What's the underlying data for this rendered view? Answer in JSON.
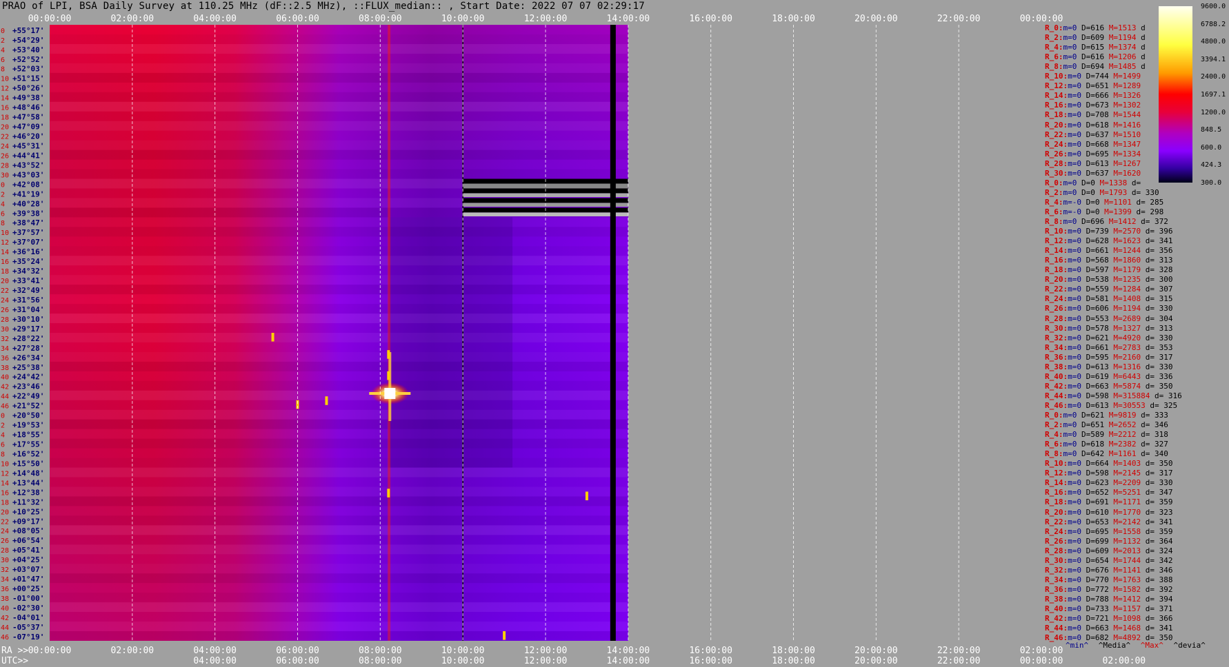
{
  "title": "PRAO of LPI, BSA Daily Survey at 110.25 MHz (dF::2.5 MHz), ::FLUX_median:: , Start Date: 2022 07 07 02:29:17",
  "chart_data": {
    "type": "heatmap",
    "top_axis_ticks": [
      "00:00:00",
      "02:00:00",
      "04:00:00",
      "06:00:00",
      "08:00:00",
      "10:00:00",
      "12:00:00",
      "14:00:00",
      "16:00:00",
      "18:00:00",
      "20:00:00",
      "22:00:00",
      "00:00:00"
    ],
    "ra_axis_label": "RA >>",
    "ra_ticks": [
      "00:00:00",
      "02:00:00",
      "04:00:00",
      "06:00:00",
      "08:00:00",
      "10:00:00",
      "12:00:00",
      "14:00:00",
      "16:00:00",
      "18:00:00",
      "20:00:00",
      "22:00:00",
      "02:00:00"
    ],
    "utc_axis_label": "UTC>>",
    "utc_ticks": [
      "04:00:00",
      "06:00:00",
      "08:00:00",
      "10:00:00",
      "12:00:00",
      "14:00:00",
      "16:00:00",
      "18:00:00",
      "20:00:00",
      "22:00:00",
      "00:00:00",
      "02:00:00"
    ],
    "row_numbers": [
      "0",
      "2",
      "4",
      "6",
      "8",
      "10",
      "12",
      "14",
      "16",
      "18",
      "20",
      "22",
      "24",
      "26",
      "28",
      "30",
      "0",
      "2",
      "4",
      "6",
      "8",
      "10",
      "12",
      "14",
      "16",
      "18",
      "20",
      "22",
      "24",
      "26",
      "28",
      "30",
      "32",
      "34",
      "36",
      "38",
      "40",
      "42",
      "44",
      "46",
      "0",
      "2",
      "4",
      "6",
      "8",
      "10",
      "12",
      "14",
      "16",
      "18",
      "20",
      "22",
      "24",
      "26",
      "28",
      "30",
      "32",
      "34",
      "36",
      "38",
      "40",
      "42",
      "44",
      "46"
    ],
    "declinations": [
      "+55°17'",
      "+54°29'",
      "+53°40'",
      "+52°52'",
      "+52°03'",
      "+51°15'",
      "+50°26'",
      "+49°38'",
      "+48°46'",
      "+47°58'",
      "+47°09'",
      "+46°20'",
      "+45°31'",
      "+44°41'",
      "+43°52'",
      "+43°03'",
      "+42°08'",
      "+41°19'",
      "+40°28'",
      "+39°38'",
      "+38°47'",
      "+37°57'",
      "+37°07'",
      "+36°16'",
      "+35°24'",
      "+34°32'",
      "+33°41'",
      "+32°49'",
      "+31°56'",
      "+31°04'",
      "+30°10'",
      "+29°17'",
      "+28°22'",
      "+27°28'",
      "+26°34'",
      "+25°38'",
      "+24°42'",
      "+23°46'",
      "+22°49'",
      "+21°52'",
      "+20°50'",
      "+19°53'",
      "+18°55'",
      "+17°55'",
      "+16°52'",
      "+15°50'",
      "+14°48'",
      "+13°44'",
      "+12°38'",
      "+11°32'",
      "+10°25'",
      "+09°17'",
      "+08°05'",
      "+06°54'",
      "+05°41'",
      "+04°25'",
      "+03°07'",
      "+01°47'",
      "+00°25'",
      "-01°00'",
      "-02°30'",
      "-04°01'",
      "-05°37'",
      "-07°19'"
    ],
    "colorbar_ticks": [
      "9600.0",
      "6788.2",
      "4800.0",
      "3394.1",
      "2400.0",
      "1697.1",
      "1200.0",
      "848.5",
      "600.0",
      "424.3",
      "300.0"
    ],
    "data_end_hour": 14.0,
    "dropout_start_hour": 10.0,
    "colors": {
      "hot": "#e8002a",
      "warm": "#c800a0",
      "cool": "#8a00ff",
      "cold": "#6a00d8",
      "background": "#a0a0a0",
      "source": "#ffffc0"
    }
  },
  "stats": [
    {
      "label": "R_0:",
      "m": "m=0",
      "D": "D=616",
      "M": "M=1513",
      "d": "d"
    },
    {
      "label": "R_2:",
      "m": "m=0",
      "D": "D=609",
      "M": "M=1194",
      "d": "d"
    },
    {
      "label": "R_4:",
      "m": "m=0",
      "D": "D=615",
      "M": "M=1374",
      "d": "d"
    },
    {
      "label": "R_6:",
      "m": "m=0",
      "D": "D=616",
      "M": "M=1206",
      "d": "d"
    },
    {
      "label": "R_8:",
      "m": "m=0",
      "D": "D=694",
      "M": "M=1485",
      "d": "d"
    },
    {
      "label": "R_10:",
      "m": "m=0",
      "D": "D=744",
      "M": "M=1499",
      "d": ""
    },
    {
      "label": "R_12:",
      "m": "m=0",
      "D": "D=651",
      "M": "M=1289",
      "d": ""
    },
    {
      "label": "R_14:",
      "m": "m=0",
      "D": "D=666",
      "M": "M=1326",
      "d": ""
    },
    {
      "label": "R_16:",
      "m": "m=0",
      "D": "D=673",
      "M": "M=1302",
      "d": ""
    },
    {
      "label": "R_18:",
      "m": "m=0",
      "D": "D=708",
      "M": "M=1544",
      "d": ""
    },
    {
      "label": "R_20:",
      "m": "m=0",
      "D": "D=618",
      "M": "M=1416",
      "d": ""
    },
    {
      "label": "R_22:",
      "m": "m=0",
      "D": "D=637",
      "M": "M=1510",
      "d": ""
    },
    {
      "label": "R_24:",
      "m": "m=0",
      "D": "D=668",
      "M": "M=1347",
      "d": ""
    },
    {
      "label": "R_26:",
      "m": "m=0",
      "D": "D=695",
      "M": "M=1334",
      "d": ""
    },
    {
      "label": "R_28:",
      "m": "m=0",
      "D": "D=613",
      "M": "M=1267",
      "d": ""
    },
    {
      "label": "R_30:",
      "m": "m=0",
      "D": "D=637",
      "M": "M=1620",
      "d": ""
    },
    {
      "label": "R_0:",
      "m": "m=0",
      "D": "D=0",
      "M": "M=1338",
      "d": "d="
    },
    {
      "label": "R_2:",
      "m": "m=0",
      "D": "D=0",
      "M": "M=1793",
      "d": "d= 330"
    },
    {
      "label": "R_4:",
      "m": "m=-0",
      "D": "D=0",
      "M": "M=1101",
      "d": "d= 285"
    },
    {
      "label": "R_6:",
      "m": "m=-0",
      "D": "D=0",
      "M": "M=1399",
      "d": "d= 298"
    },
    {
      "label": "R_8:",
      "m": "m=0",
      "D": "D=696",
      "M": "M=1412",
      "d": "d= 372"
    },
    {
      "label": "R_10:",
      "m": "m=0",
      "D": "D=739",
      "M": "M=2570",
      "d": "d= 396"
    },
    {
      "label": "R_12:",
      "m": "m=0",
      "D": "D=628",
      "M": "M=1623",
      "d": "d= 341"
    },
    {
      "label": "R_14:",
      "m": "m=0",
      "D": "D=661",
      "M": "M=1244",
      "d": "d= 356"
    },
    {
      "label": "R_16:",
      "m": "m=0",
      "D": "D=568",
      "M": "M=1860",
      "d": "d= 313"
    },
    {
      "label": "R_18:",
      "m": "m=0",
      "D": "D=597",
      "M": "M=1179",
      "d": "d= 328"
    },
    {
      "label": "R_20:",
      "m": "m=0",
      "D": "D=538",
      "M": "M=1235",
      "d": "d= 300"
    },
    {
      "label": "R_22:",
      "m": "m=0",
      "D": "D=559",
      "M": "M=1284",
      "d": "d= 307"
    },
    {
      "label": "R_24:",
      "m": "m=0",
      "D": "D=581",
      "M": "M=1408",
      "d": "d= 315"
    },
    {
      "label": "R_26:",
      "m": "m=0",
      "D": "D=606",
      "M": "M=1194",
      "d": "d= 330"
    },
    {
      "label": "R_28:",
      "m": "m=0",
      "D": "D=553",
      "M": "M=2689",
      "d": "d= 304"
    },
    {
      "label": "R_30:",
      "m": "m=0",
      "D": "D=578",
      "M": "M=1327",
      "d": "d= 313"
    },
    {
      "label": "R_32:",
      "m": "m=0",
      "D": "D=621",
      "M": "M=4920",
      "d": "d= 330"
    },
    {
      "label": "R_34:",
      "m": "m=0",
      "D": "D=661",
      "M": "M=2783",
      "d": "d= 353"
    },
    {
      "label": "R_36:",
      "m": "m=0",
      "D": "D=595",
      "M": "M=2160",
      "d": "d= 317"
    },
    {
      "label": "R_38:",
      "m": "m=0",
      "D": "D=613",
      "M": "M=1316",
      "d": "d= 330"
    },
    {
      "label": "R_40:",
      "m": "m=0",
      "D": "D=619",
      "M": "M=6443",
      "d": "d= 336"
    },
    {
      "label": "R_42:",
      "m": "m=0",
      "D": "D=663",
      "M": "M=5874",
      "d": "d= 350"
    },
    {
      "label": "R_44:",
      "m": "m=0",
      "D": "D=598",
      "M": "M=315884",
      "d": "d= 316"
    },
    {
      "label": "R_46:",
      "m": "m=0",
      "D": "D=613",
      "M": "M=30553",
      "d": "d= 325"
    },
    {
      "label": "R_0:",
      "m": "m=0",
      "D": "D=621",
      "M": "M=9819",
      "d": "d= 333"
    },
    {
      "label": "R_2:",
      "m": "m=0",
      "D": "D=651",
      "M": "M=2652",
      "d": "d= 346"
    },
    {
      "label": "R_4:",
      "m": "m=0",
      "D": "D=589",
      "M": "M=2212",
      "d": "d= 318"
    },
    {
      "label": "R_6:",
      "m": "m=0",
      "D": "D=618",
      "M": "M=2382",
      "d": "d= 327"
    },
    {
      "label": "R_8:",
      "m": "m=0",
      "D": "D=642",
      "M": "M=1161",
      "d": "d= 340"
    },
    {
      "label": "R_10:",
      "m": "m=0",
      "D": "D=664",
      "M": "M=1403",
      "d": "d= 350"
    },
    {
      "label": "R_12:",
      "m": "m=0",
      "D": "D=598",
      "M": "M=2145",
      "d": "d= 317"
    },
    {
      "label": "R_14:",
      "m": "m=0",
      "D": "D=623",
      "M": "M=2209",
      "d": "d= 330"
    },
    {
      "label": "R_16:",
      "m": "m=0",
      "D": "D=652",
      "M": "M=5251",
      "d": "d= 347"
    },
    {
      "label": "R_18:",
      "m": "m=0",
      "D": "D=691",
      "M": "M=1171",
      "d": "d= 359"
    },
    {
      "label": "R_20:",
      "m": "m=0",
      "D": "D=610",
      "M": "M=1770",
      "d": "d= 323"
    },
    {
      "label": "R_22:",
      "m": "m=0",
      "D": "D=653",
      "M": "M=2142",
      "d": "d= 341"
    },
    {
      "label": "R_24:",
      "m": "m=0",
      "D": "D=695",
      "M": "M=1558",
      "d": "d= 359"
    },
    {
      "label": "R_26:",
      "m": "m=0",
      "D": "D=699",
      "M": "M=1132",
      "d": "d= 364"
    },
    {
      "label": "R_28:",
      "m": "m=0",
      "D": "D=609",
      "M": "M=2013",
      "d": "d= 324"
    },
    {
      "label": "R_30:",
      "m": "m=0",
      "D": "D=654",
      "M": "M=1744",
      "d": "d= 342"
    },
    {
      "label": "R_32:",
      "m": "m=0",
      "D": "D=676",
      "M": "M=1141",
      "d": "d= 346"
    },
    {
      "label": "R_34:",
      "m": "m=0",
      "D": "D=770",
      "M": "M=1763",
      "d": "d= 388"
    },
    {
      "label": "R_36:",
      "m": "m=0",
      "D": "D=772",
      "M": "M=1582",
      "d": "d= 392"
    },
    {
      "label": "R_38:",
      "m": "m=0",
      "D": "D=788",
      "M": "M=1412",
      "d": "d= 394"
    },
    {
      "label": "R_40:",
      "m": "m=0",
      "D": "D=733",
      "M": "M=1157",
      "d": "d= 371"
    },
    {
      "label": "R_42:",
      "m": "m=0",
      "D": "D=721",
      "M": "M=1098",
      "d": "d= 366"
    },
    {
      "label": "R_44:",
      "m": "m=0",
      "D": "D=663",
      "M": "M=1468",
      "d": "d= 341"
    },
    {
      "label": "R_46:",
      "m": "m=0",
      "D": "D=682",
      "M": "M=4892",
      "d": "d= 350"
    }
  ],
  "stats_footer": {
    "min": "^min^",
    "media": "^Media^",
    "max": "^Max^",
    "devia": "^devia^"
  }
}
